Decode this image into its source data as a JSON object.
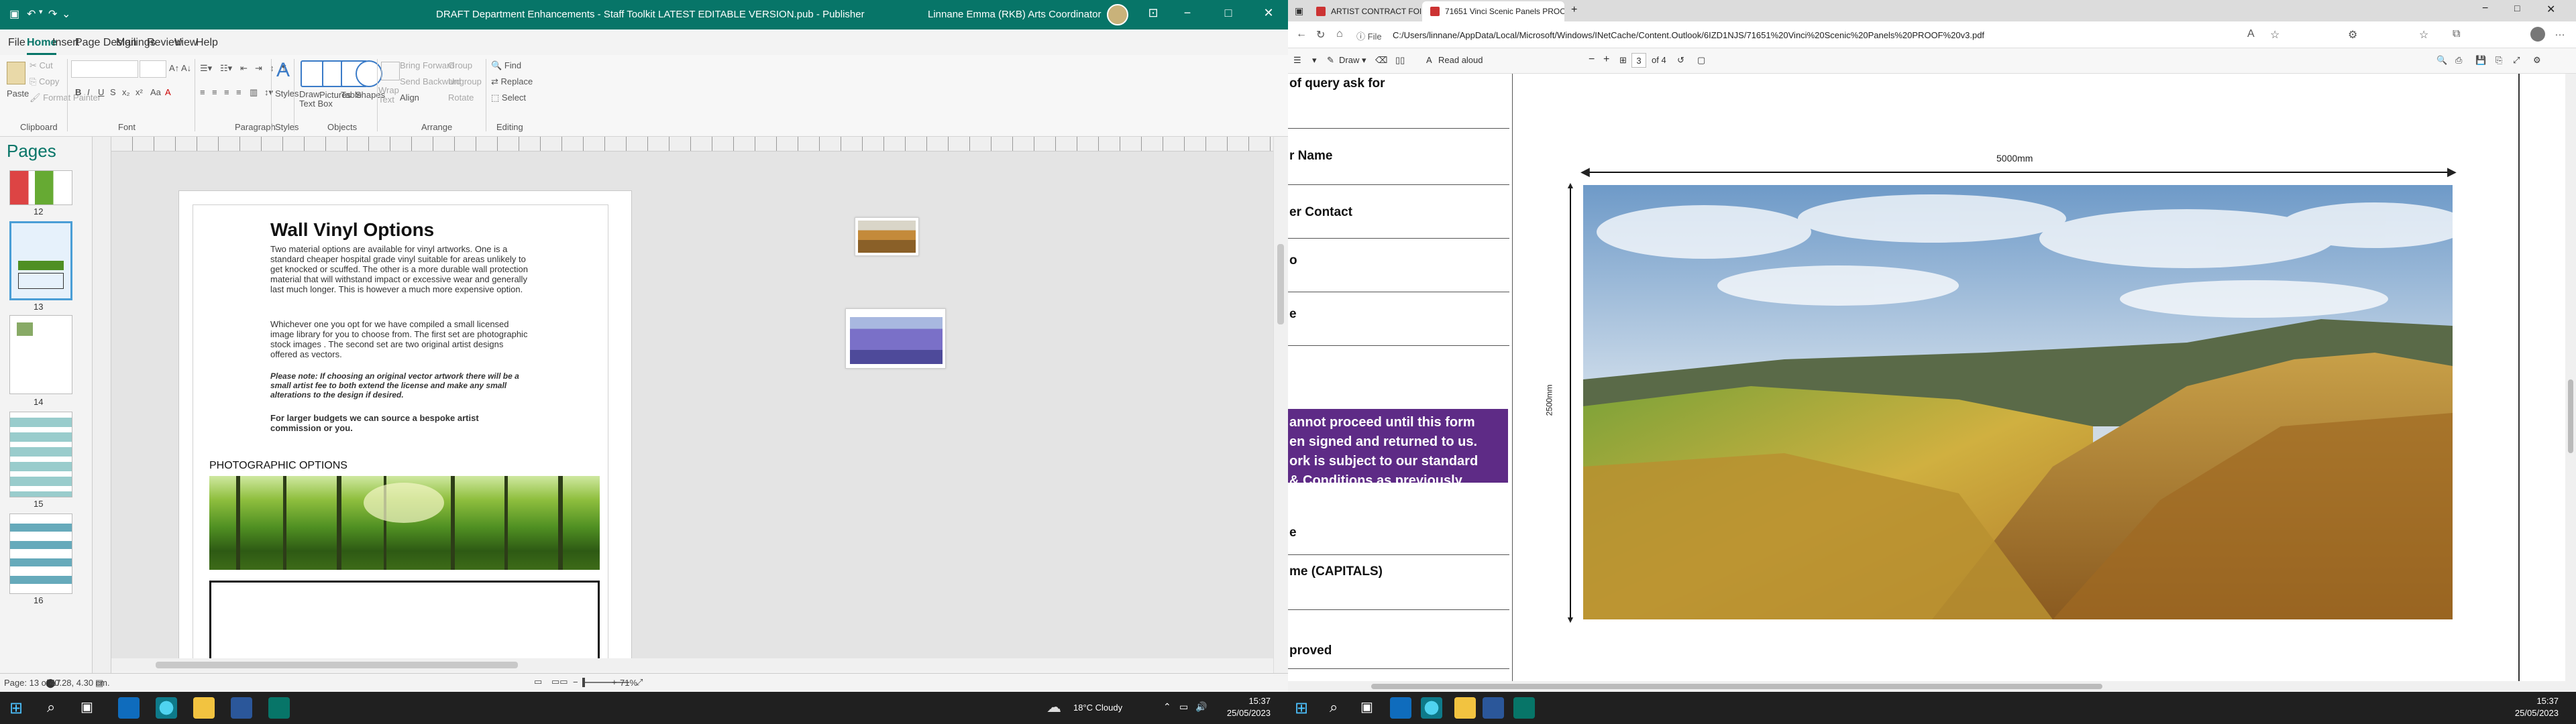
{
  "publisher": {
    "title": "DRAFT Department Enhancements - Staff Toolkit LATEST EDITABLE VERSION.pub  -  Publisher",
    "user": "Linnane Emma (RKB) Arts Coordinator",
    "window_controls": [
      "−",
      "□",
      "✕"
    ],
    "menu": [
      "File",
      "Home",
      "Insert",
      "Page Design",
      "Mailings",
      "Review",
      "View",
      "Help"
    ],
    "menu_active": "Home",
    "ribbon": {
      "clipboard": {
        "paste": "Paste",
        "cut": "Cut",
        "copy": "Copy",
        "format_painter": "Format Painter",
        "group": "Clipboard"
      },
      "font_group": "Font",
      "paragraph_group": "Paragraph",
      "styles": {
        "label": "Styles",
        "group": "Styles"
      },
      "objects": {
        "draw_text_box": "Draw Text Box",
        "pictures": "Pictures",
        "table": "Table",
        "shapes": "Shapes",
        "group": "Objects"
      },
      "arrange": {
        "wrap_text": "Wrap Text",
        "bring_forward": "Bring Forward",
        "send_backward": "Send Backward",
        "align": "Align",
        "group_btn": "Group",
        "ungroup": "Ungroup",
        "rotate": "Rotate",
        "group": "Arrange"
      },
      "editing": {
        "find": "Find",
        "replace": "Replace",
        "select": "Select",
        "group": "Editing"
      }
    },
    "pages_pane": {
      "title": "Pages",
      "thumbnails": [
        "12",
        "13",
        "14",
        "15",
        "16"
      ],
      "selected": "13"
    },
    "document": {
      "heading": "Wall Vinyl Options",
      "para1": "Two material options are available for vinyl artworks. One is a standard  cheaper hospital grade vinyl suitable for areas unlikely to get knocked or scuffed. The other is a more durable wall protection material that will withstand impact or excessive wear and generally last much longer. This is however a much more expensive option.",
      "para2": "Whichever one you opt for we have compiled a small licensed image library for you to choose from. The first set are photographic stock images . The second set are two original artist designs offered as vectors.",
      "note": "Please note: If choosing an original vector artwork there will be a small artist fee to both extend the license and make any small alterations to the design if desired.",
      "budget": "For larger budgets we can source a bespoke artist commission or you.",
      "photo_heading": "PHOTOGRAPHIC OPTIONS"
    },
    "status": {
      "page": "Page: 13 of 17",
      "position": "40.28, 4.30 cm.",
      "zoom": "71%"
    }
  },
  "edge": {
    "tabs": [
      {
        "label": "ARTIST CONTRACT FOR LOAN O",
        "active": false
      },
      {
        "label": "71651 Vinci Scenic Panels PROO",
        "active": true
      }
    ],
    "file_label": "File",
    "url": "C:/Users/linnane/AppData/Local/Microsoft/Windows/INetCache/Content.Outlook/6IZD1NJS/71651%20Vinci%20Scenic%20Panels%20PROOF%20v3.pdf",
    "pdf_toolbar": {
      "draw": "Draw",
      "read_aloud": "Read aloud",
      "page_current": "3",
      "page_total": "of 4"
    },
    "pdf": {
      "form_rows": [
        "of query ask for",
        "r Name",
        "er Contact",
        "o",
        "e",
        "e",
        "me (CAPITALS)",
        "proved"
      ],
      "notice": "annot proceed until this form\nen signed and returned to us.\nork is subject to our standard\n& Conditions as previously\nlied to and accepted by you.",
      "width_label": "5000mm",
      "height_label": "2500mm"
    }
  },
  "taskbar_left": {
    "weather": "18°C  Cloudy",
    "time": "15:37",
    "date": "25/05/2023"
  },
  "taskbar_right": {
    "time": "15:37",
    "date": "25/05/2023"
  }
}
